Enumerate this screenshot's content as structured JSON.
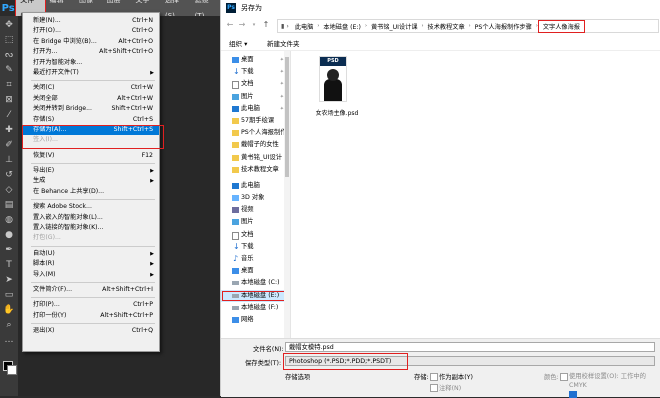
{
  "photoshop": {
    "logo": "Ps",
    "menubar": [
      "文件(F)",
      "编辑(E)",
      "图像(I)",
      "图层(L)",
      "文字(Y)",
      "选择(S)",
      "滤镜(T)"
    ],
    "file_menu": [
      {
        "label": "新建(N)...",
        "shortcut": "Ctrl+N"
      },
      {
        "label": "打开(O)...",
        "shortcut": "Ctrl+O"
      },
      {
        "label": "在 Bridge 中浏览(B)...",
        "shortcut": "Alt+Ctrl+O"
      },
      {
        "label": "打开为...",
        "shortcut": "Alt+Shift+Ctrl+O"
      },
      {
        "label": "打开为智能对象...",
        "shortcut": ""
      },
      {
        "label": "最近打开文件(T)",
        "shortcut": ""
      },
      {
        "label": "关闭(C)",
        "shortcut": "Ctrl+W"
      },
      {
        "label": "关闭全部",
        "shortcut": "Alt+Ctrl+W"
      },
      {
        "label": "关闭并转到 Bridge...",
        "shortcut": "Shift+Ctrl+W"
      },
      {
        "label": "存储(S)",
        "shortcut": "Ctrl+S"
      },
      {
        "label": "存储为(A)...",
        "shortcut": "Shift+Ctrl+S"
      },
      {
        "label": "签入(I)...",
        "shortcut": ""
      },
      {
        "label": "恢复(V)",
        "shortcut": "F12"
      },
      {
        "label": "导出(E)",
        "shortcut": ""
      },
      {
        "label": "生成",
        "shortcut": ""
      },
      {
        "label": "在 Behance 上共享(D)...",
        "shortcut": ""
      },
      {
        "label": "搜索 Adobe Stock...",
        "shortcut": ""
      },
      {
        "label": "置入嵌入的智能对象(L)...",
        "shortcut": ""
      },
      {
        "label": "置入链接的智能对象(K)...",
        "shortcut": ""
      },
      {
        "label": "打包(G)...",
        "shortcut": ""
      },
      {
        "label": "自动(U)",
        "shortcut": ""
      },
      {
        "label": "脚本(R)",
        "shortcut": ""
      },
      {
        "label": "导入(M)",
        "shortcut": ""
      },
      {
        "label": "文件简介(F)...",
        "shortcut": "Alt+Shift+Ctrl+I"
      },
      {
        "label": "打印(P)...",
        "shortcut": "Ctrl+P"
      },
      {
        "label": "打印一份(Y)",
        "shortcut": "Alt+Shift+Ctrl+P"
      },
      {
        "label": "退出(X)",
        "shortcut": "Ctrl+Q"
      }
    ]
  },
  "dialog": {
    "title": "另存为",
    "breadcrumb": [
      "此电脑",
      "本地磁盘 (E:)",
      "黄书铭_UI设计课",
      "技术教程文章",
      "PS个人海报制作步骤",
      "文字人像海报"
    ],
    "toolbar": {
      "organize": "组织 ▾",
      "new_folder": "新建文件夹"
    },
    "nav_items": [
      {
        "label": "桌面",
        "icon": "desktop-icon"
      },
      {
        "label": "下载",
        "icon": "download-icon"
      },
      {
        "label": "文档",
        "icon": "document-icon"
      },
      {
        "label": "图片",
        "icon": "picture-icon"
      },
      {
        "label": "此电脑",
        "icon": "computer-icon"
      },
      {
        "label": "57期手绘课",
        "icon": "folder-icon"
      },
      {
        "label": "PS个人海报制作",
        "icon": "folder-icon"
      },
      {
        "label": "戴帽子的女性",
        "icon": "folder-icon"
      },
      {
        "label": "黄书铭_UI设计",
        "icon": "folder-icon"
      },
      {
        "label": "技术教程文章",
        "icon": "folder-icon"
      },
      {
        "label": "此电脑",
        "icon": "computer-icon"
      },
      {
        "label": "3D 对象",
        "icon": "3d-icon"
      },
      {
        "label": "视频",
        "icon": "video-icon"
      },
      {
        "label": "图片",
        "icon": "picture-icon"
      },
      {
        "label": "文档",
        "icon": "document-icon"
      },
      {
        "label": "下载",
        "icon": "download-icon"
      },
      {
        "label": "音乐",
        "icon": "music-icon"
      },
      {
        "label": "桌面",
        "icon": "desktop-icon"
      },
      {
        "label": "本地磁盘 (C:)",
        "icon": "drive-icon"
      },
      {
        "label": "本地磁盘 (E:)",
        "icon": "drive-icon"
      },
      {
        "label": "本地磁盘 (F:)",
        "icon": "drive-icon"
      },
      {
        "label": "网络",
        "icon": "network-icon"
      }
    ],
    "file": {
      "thumb_label": "PSD",
      "name": "女农场主像.psd"
    },
    "filename_label": "文件名(N):",
    "filename_value": "戴帽女模特.psd",
    "filetype_label": "保存类型(T):",
    "filetype_value": "Photoshop (*.PSD;*.PDD;*.PSDT)",
    "options_label": "存储选项",
    "storage_label": "存储:",
    "as_copy": "作为副本(Y)",
    "notes": "注释(N)",
    "color_label": "颜色:",
    "proof_setup": "使用校样设置(O):  工作中的 CMYK"
  }
}
